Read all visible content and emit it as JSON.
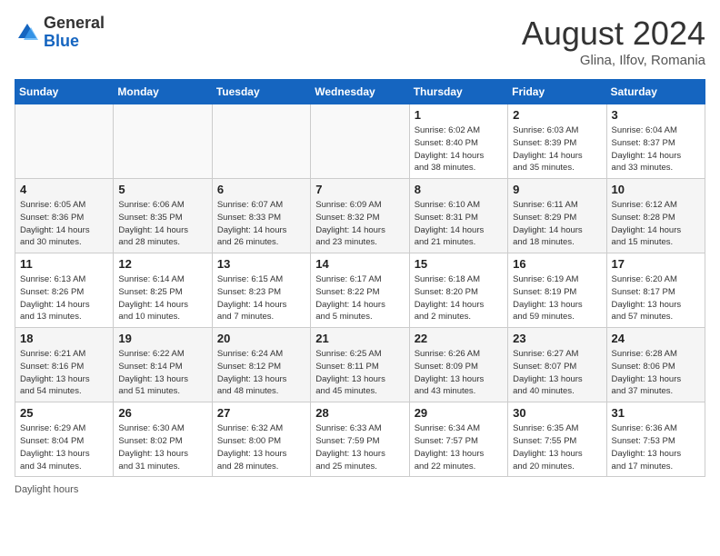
{
  "header": {
    "logo_general": "General",
    "logo_blue": "Blue",
    "month_year": "August 2024",
    "location": "Glina, Ilfov, Romania"
  },
  "footer": {
    "daylight_label": "Daylight hours"
  },
  "weekdays": [
    "Sunday",
    "Monday",
    "Tuesday",
    "Wednesday",
    "Thursday",
    "Friday",
    "Saturday"
  ],
  "weeks": [
    [
      {
        "day": "",
        "info": ""
      },
      {
        "day": "",
        "info": ""
      },
      {
        "day": "",
        "info": ""
      },
      {
        "day": "",
        "info": ""
      },
      {
        "day": "1",
        "info": "Sunrise: 6:02 AM\nSunset: 8:40 PM\nDaylight: 14 hours\nand 38 minutes."
      },
      {
        "day": "2",
        "info": "Sunrise: 6:03 AM\nSunset: 8:39 PM\nDaylight: 14 hours\nand 35 minutes."
      },
      {
        "day": "3",
        "info": "Sunrise: 6:04 AM\nSunset: 8:37 PM\nDaylight: 14 hours\nand 33 minutes."
      }
    ],
    [
      {
        "day": "4",
        "info": "Sunrise: 6:05 AM\nSunset: 8:36 PM\nDaylight: 14 hours\nand 30 minutes."
      },
      {
        "day": "5",
        "info": "Sunrise: 6:06 AM\nSunset: 8:35 PM\nDaylight: 14 hours\nand 28 minutes."
      },
      {
        "day": "6",
        "info": "Sunrise: 6:07 AM\nSunset: 8:33 PM\nDaylight: 14 hours\nand 26 minutes."
      },
      {
        "day": "7",
        "info": "Sunrise: 6:09 AM\nSunset: 8:32 PM\nDaylight: 14 hours\nand 23 minutes."
      },
      {
        "day": "8",
        "info": "Sunrise: 6:10 AM\nSunset: 8:31 PM\nDaylight: 14 hours\nand 21 minutes."
      },
      {
        "day": "9",
        "info": "Sunrise: 6:11 AM\nSunset: 8:29 PM\nDaylight: 14 hours\nand 18 minutes."
      },
      {
        "day": "10",
        "info": "Sunrise: 6:12 AM\nSunset: 8:28 PM\nDaylight: 14 hours\nand 15 minutes."
      }
    ],
    [
      {
        "day": "11",
        "info": "Sunrise: 6:13 AM\nSunset: 8:26 PM\nDaylight: 14 hours\nand 13 minutes."
      },
      {
        "day": "12",
        "info": "Sunrise: 6:14 AM\nSunset: 8:25 PM\nDaylight: 14 hours\nand 10 minutes."
      },
      {
        "day": "13",
        "info": "Sunrise: 6:15 AM\nSunset: 8:23 PM\nDaylight: 14 hours\nand 7 minutes."
      },
      {
        "day": "14",
        "info": "Sunrise: 6:17 AM\nSunset: 8:22 PM\nDaylight: 14 hours\nand 5 minutes."
      },
      {
        "day": "15",
        "info": "Sunrise: 6:18 AM\nSunset: 8:20 PM\nDaylight: 14 hours\nand 2 minutes."
      },
      {
        "day": "16",
        "info": "Sunrise: 6:19 AM\nSunset: 8:19 PM\nDaylight: 13 hours\nand 59 minutes."
      },
      {
        "day": "17",
        "info": "Sunrise: 6:20 AM\nSunset: 8:17 PM\nDaylight: 13 hours\nand 57 minutes."
      }
    ],
    [
      {
        "day": "18",
        "info": "Sunrise: 6:21 AM\nSunset: 8:16 PM\nDaylight: 13 hours\nand 54 minutes."
      },
      {
        "day": "19",
        "info": "Sunrise: 6:22 AM\nSunset: 8:14 PM\nDaylight: 13 hours\nand 51 minutes."
      },
      {
        "day": "20",
        "info": "Sunrise: 6:24 AM\nSunset: 8:12 PM\nDaylight: 13 hours\nand 48 minutes."
      },
      {
        "day": "21",
        "info": "Sunrise: 6:25 AM\nSunset: 8:11 PM\nDaylight: 13 hours\nand 45 minutes."
      },
      {
        "day": "22",
        "info": "Sunrise: 6:26 AM\nSunset: 8:09 PM\nDaylight: 13 hours\nand 43 minutes."
      },
      {
        "day": "23",
        "info": "Sunrise: 6:27 AM\nSunset: 8:07 PM\nDaylight: 13 hours\nand 40 minutes."
      },
      {
        "day": "24",
        "info": "Sunrise: 6:28 AM\nSunset: 8:06 PM\nDaylight: 13 hours\nand 37 minutes."
      }
    ],
    [
      {
        "day": "25",
        "info": "Sunrise: 6:29 AM\nSunset: 8:04 PM\nDaylight: 13 hours\nand 34 minutes."
      },
      {
        "day": "26",
        "info": "Sunrise: 6:30 AM\nSunset: 8:02 PM\nDaylight: 13 hours\nand 31 minutes."
      },
      {
        "day": "27",
        "info": "Sunrise: 6:32 AM\nSunset: 8:00 PM\nDaylight: 13 hours\nand 28 minutes."
      },
      {
        "day": "28",
        "info": "Sunrise: 6:33 AM\nSunset: 7:59 PM\nDaylight: 13 hours\nand 25 minutes."
      },
      {
        "day": "29",
        "info": "Sunrise: 6:34 AM\nSunset: 7:57 PM\nDaylight: 13 hours\nand 22 minutes."
      },
      {
        "day": "30",
        "info": "Sunrise: 6:35 AM\nSunset: 7:55 PM\nDaylight: 13 hours\nand 20 minutes."
      },
      {
        "day": "31",
        "info": "Sunrise: 6:36 AM\nSunset: 7:53 PM\nDaylight: 13 hours\nand 17 minutes."
      }
    ]
  ]
}
